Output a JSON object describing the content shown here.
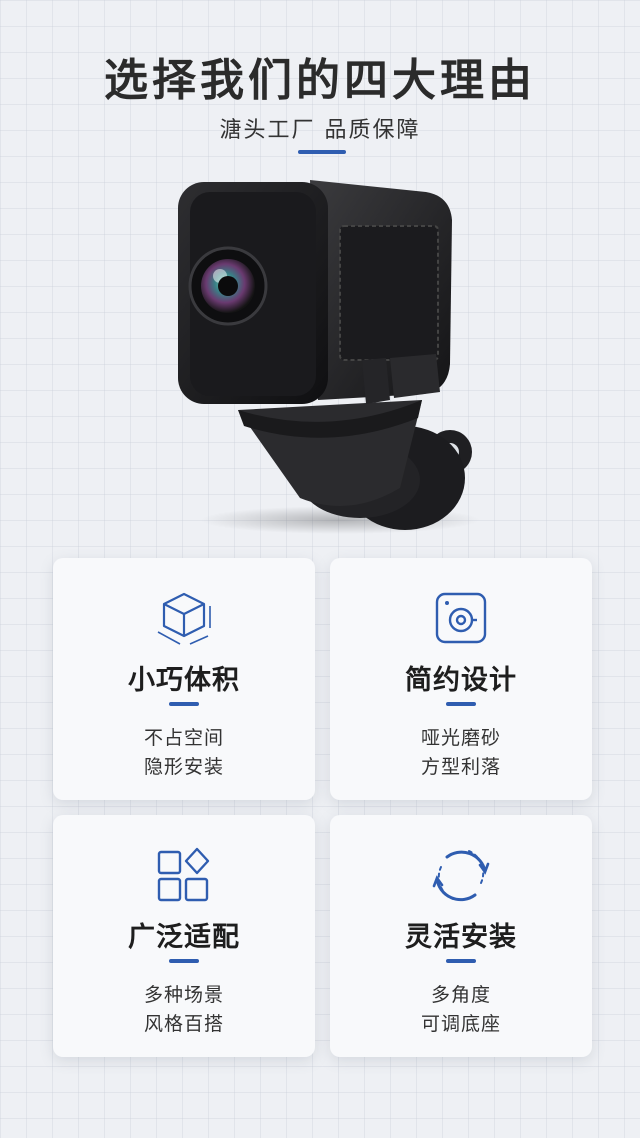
{
  "header": {
    "title": "选择我们的四大理由",
    "subtitle": "溏头工厂 品质保障"
  },
  "colors": {
    "accent": "#2f5db0",
    "background": "#eef0f4",
    "card": "#f8f9fb"
  },
  "features": [
    {
      "icon": "cube-dimensions-icon",
      "title": "小巧体积",
      "line1": "不占空间",
      "line2": "隐形安装"
    },
    {
      "icon": "camera-square-icon",
      "title": "简约设计",
      "line1": "哑光磨砂",
      "line2": "方型利落"
    },
    {
      "icon": "grid-apps-icon",
      "title": "广泛适配",
      "line1": "多种场景",
      "line2": "风格百搭"
    },
    {
      "icon": "rotate-arrows-icon",
      "title": "灵活安装",
      "line1": "多角度",
      "line2": "可调底座"
    }
  ]
}
